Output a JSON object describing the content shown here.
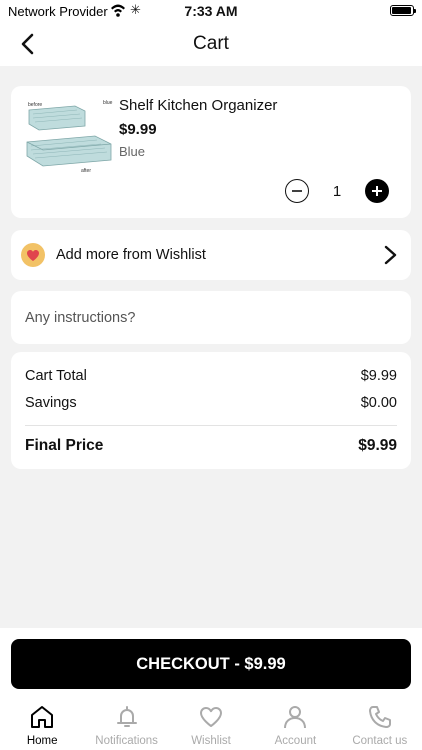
{
  "status_bar": {
    "carrier": "Network Provider",
    "time": "7:33 AM"
  },
  "header": {
    "title": "Cart"
  },
  "cart_item": {
    "name": "Shelf Kitchen Organizer",
    "price": "$9.99",
    "variant": "Blue",
    "quantity": "1",
    "thumbnail_text": [
      "before",
      "blue",
      "after"
    ]
  },
  "wishlist": {
    "label": "Add more from Wishlist"
  },
  "instructions": {
    "placeholder": "Any instructions?"
  },
  "totals": {
    "cart_total_label": "Cart Total",
    "cart_total_value": "$9.99",
    "savings_label": "Savings",
    "savings_value": "$0.00",
    "final_label": "Final Price",
    "final_value": "$9.99"
  },
  "checkout": {
    "label": "CHECKOUT - $9.99"
  },
  "tabs": [
    {
      "label": "Home",
      "icon": "home-icon",
      "active": true
    },
    {
      "label": "Notifications",
      "icon": "bell-icon",
      "active": false
    },
    {
      "label": "Wishlist",
      "icon": "heart-icon",
      "active": false
    },
    {
      "label": "Account",
      "icon": "user-icon",
      "active": false
    },
    {
      "label": "Contact us",
      "icon": "phone-icon",
      "active": false
    }
  ],
  "colors": {
    "accent": "#000000",
    "wishlist_badge": "#f2c266",
    "heart": "#e0454d",
    "product_blue": "#a9cfd0"
  }
}
